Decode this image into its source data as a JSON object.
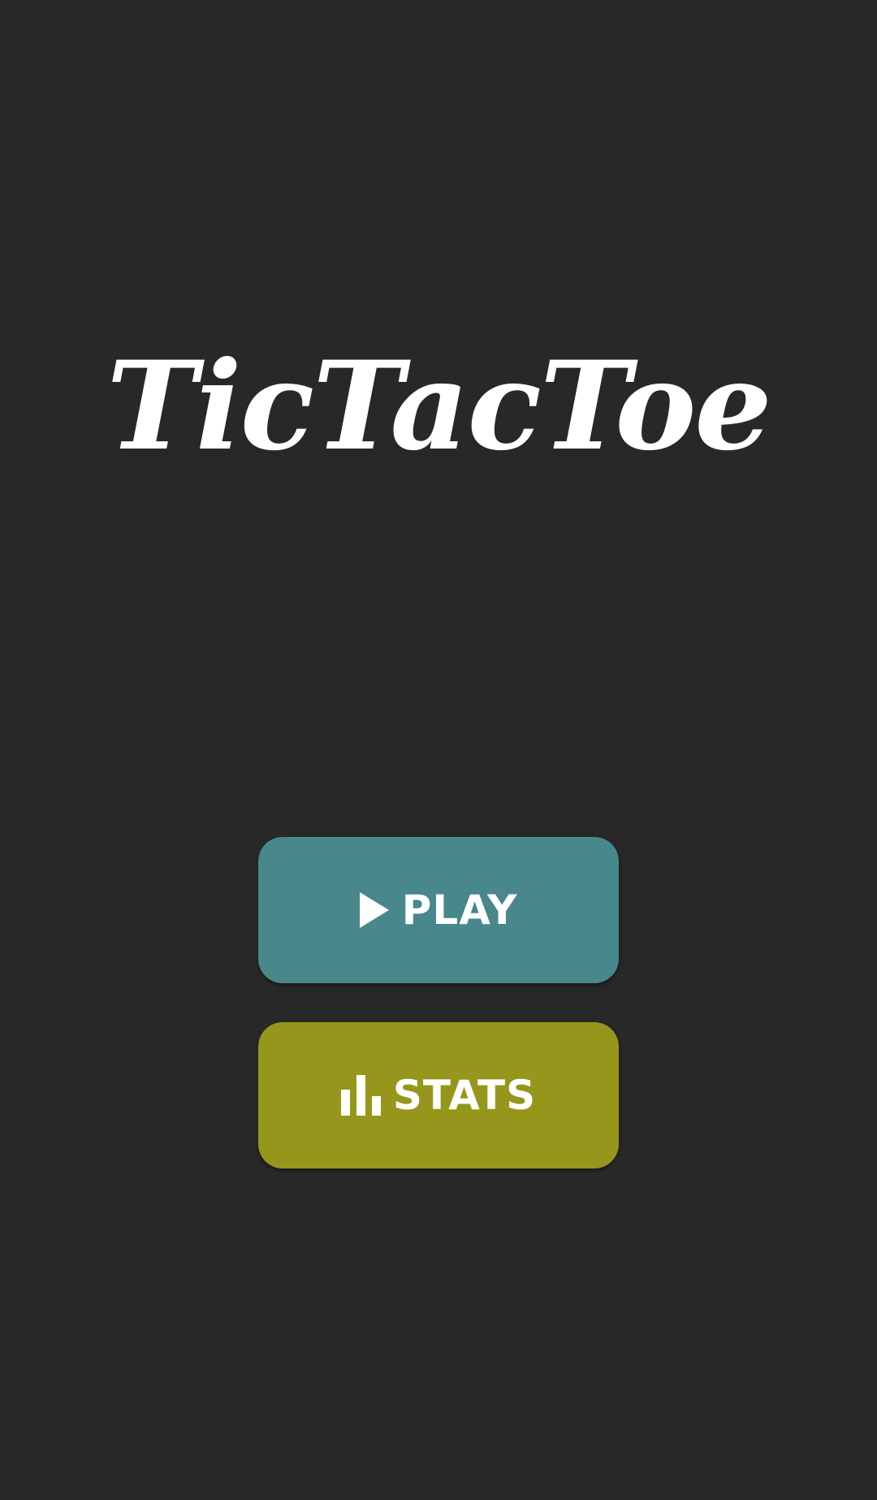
{
  "app": {
    "title": "TicTacToe"
  },
  "menu": {
    "play_label": "PLAY",
    "play_icon": "play-icon",
    "stats_label": "STATS",
    "stats_icon": "bar-chart-icon"
  },
  "colors": {
    "background": "#282828",
    "play_button": "#48878A",
    "stats_button": "#96961C",
    "text": "#FFFFFF"
  }
}
